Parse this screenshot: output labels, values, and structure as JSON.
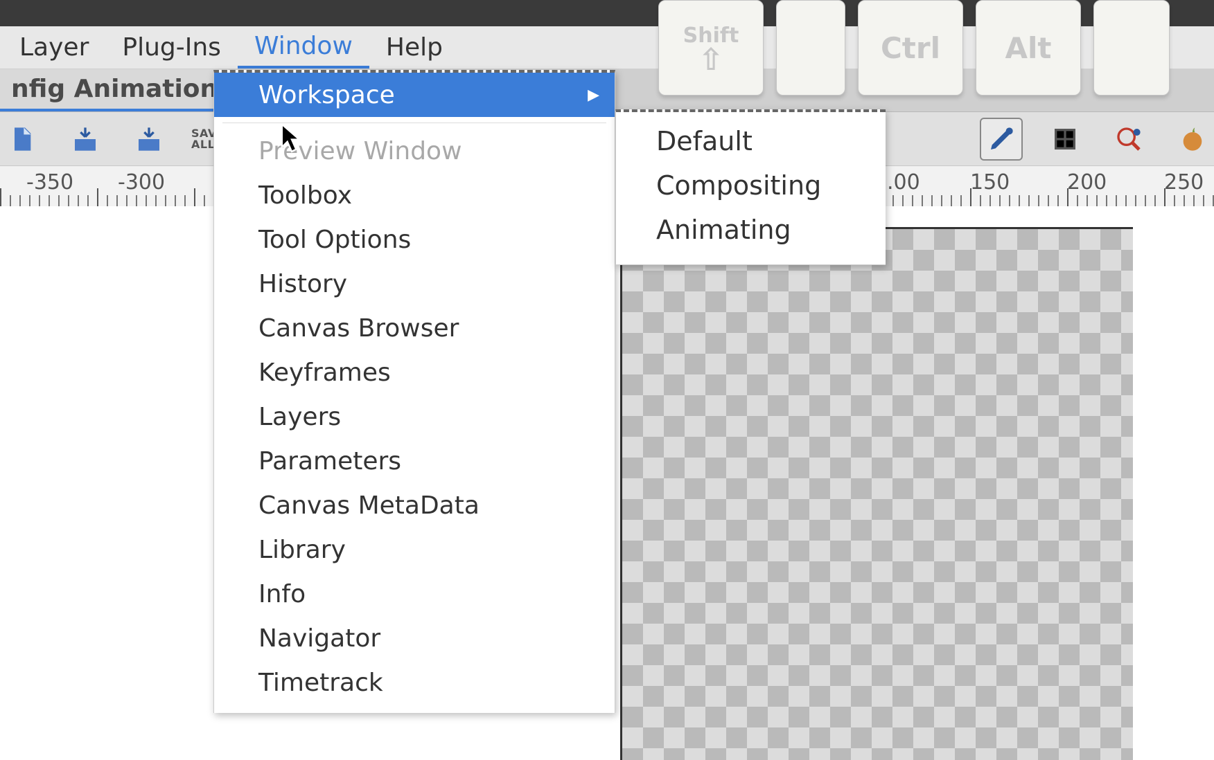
{
  "menubar": {
    "items": [
      "Layer",
      "Plug-Ins",
      "Window",
      "Help"
    ],
    "active_index": 2
  },
  "tab": {
    "label": "nfig Animation"
  },
  "toolbar": {
    "save_all_label": "SAVE\nALL"
  },
  "keycaps": {
    "shift": "Shift",
    "ctrl": "Ctrl",
    "alt": "Alt"
  },
  "ruler": {
    "labels": [
      "-350",
      "-300",
      "",
      ".00",
      "150",
      "200",
      "250"
    ],
    "positions": [
      38,
      170,
      0,
      1280,
      1400,
      1540,
      1680
    ]
  },
  "window_menu": {
    "items": [
      {
        "label": "Workspace",
        "highlight": true,
        "submenu": true
      },
      {
        "label": "Preview Window",
        "disabled": true
      },
      {
        "label": "Toolbox"
      },
      {
        "label": "Tool Options"
      },
      {
        "label": "History"
      },
      {
        "label": "Canvas Browser"
      },
      {
        "label": "Keyframes"
      },
      {
        "label": "Layers"
      },
      {
        "label": "Parameters"
      },
      {
        "label": "Canvas MetaData"
      },
      {
        "label": "Library"
      },
      {
        "label": "Info"
      },
      {
        "label": "Navigator"
      },
      {
        "label": "Timetrack"
      }
    ]
  },
  "workspace_submenu": {
    "items": [
      {
        "label": "Default"
      },
      {
        "label": "Compositing"
      },
      {
        "label": "Animating"
      }
    ]
  },
  "icons": {
    "file": "file-icon",
    "save_down": "save-download-icon",
    "save_down2": "save-download-icon",
    "pencil": "pencil-icon",
    "grid": "grid-icon",
    "magnify": "snap-icon",
    "onion": "onion-skin-icon"
  }
}
